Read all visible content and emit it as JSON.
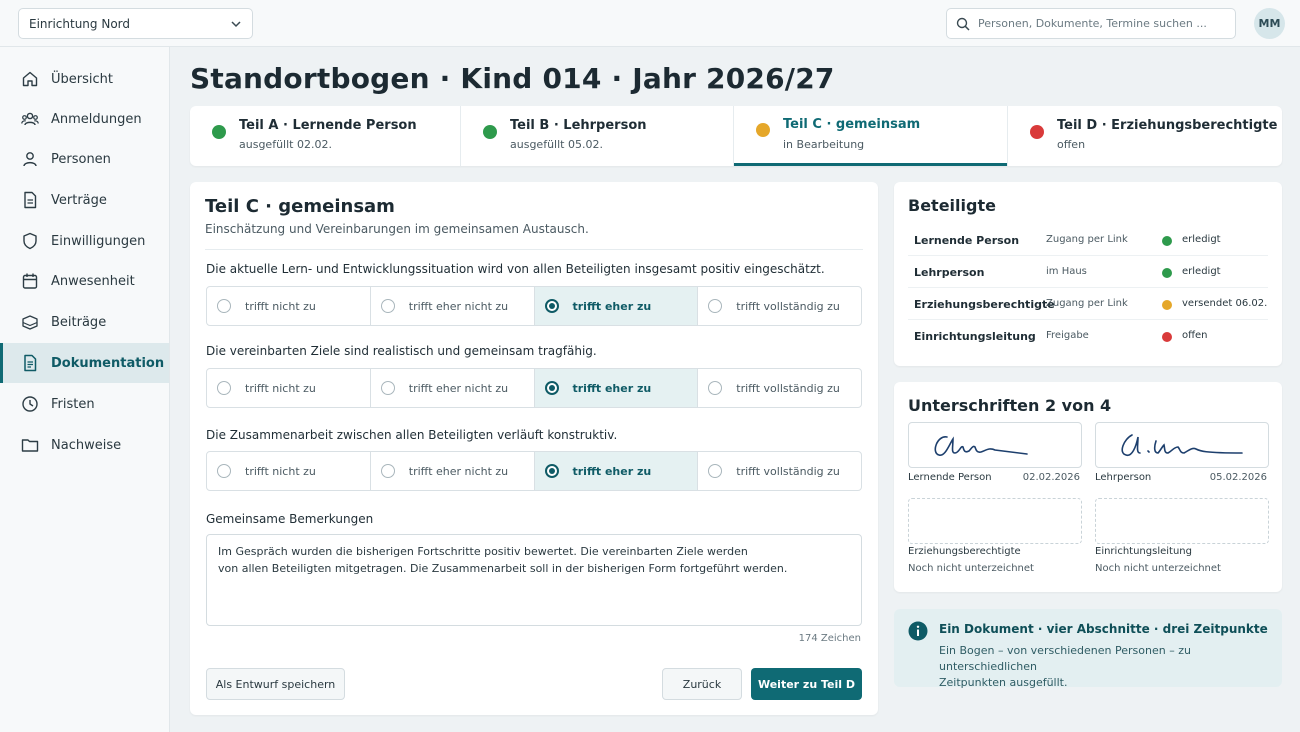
{
  "header": {
    "org_select": "Einrichtung Nord",
    "search_placeholder": "Personen, Dokumente, Termine suchen ...",
    "avatar": "MM"
  },
  "sidebar": {
    "items": [
      {
        "label": "Übersicht",
        "icon": "home-icon"
      },
      {
        "label": "Anmeldungen",
        "icon": "users-icon"
      },
      {
        "label": "Personen",
        "icon": "person-icon"
      },
      {
        "label": "Verträge",
        "icon": "document-icon"
      },
      {
        "label": "Einwilligungen",
        "icon": "shield-icon"
      },
      {
        "label": "Anwesenheit",
        "icon": "calendar-icon"
      },
      {
        "label": "Beiträge",
        "icon": "money-icon"
      },
      {
        "label": "Dokumentation",
        "icon": "document-list-icon",
        "active": true
      },
      {
        "label": "Fristen",
        "icon": "clock-icon"
      },
      {
        "label": "Nachweise",
        "icon": "folder-icon"
      }
    ]
  },
  "page": {
    "title": "Standortbogen · Kind 014 · Jahr 2026/27"
  },
  "steps": [
    {
      "title": "Teil A · Lernende Person",
      "subtitle": "ausgefüllt 02.02.",
      "status_color": "#2e9a4c"
    },
    {
      "title": "Teil B · Lehrperson",
      "subtitle": "ausgefüllt 05.02.",
      "status_color": "#2e9a4c"
    },
    {
      "title": "Teil C · gemeinsam",
      "subtitle": "in Bearbeitung",
      "status_color": "#e5a72a",
      "current": true
    },
    {
      "title": "Teil D · Erziehungsberechtigte",
      "subtitle": "offen",
      "status_color": "#d93a3a"
    }
  ],
  "section": {
    "title": "Teil C · gemeinsam",
    "subtitle": "Einschätzung und Vereinbarungen im gemeinsamen Austausch.",
    "options": [
      "trifft nicht zu",
      "trifft eher nicht zu",
      "trifft eher zu",
      "trifft vollständig zu"
    ],
    "questions": [
      {
        "text": "Die aktuelle Lern- und Entwicklungssituation wird von allen Beteiligten insgesamt positiv eingeschätzt.",
        "selected": 2
      },
      {
        "text": "Die vereinbarten Ziele sind realistisch und gemeinsam tragfähig.",
        "selected": 2
      },
      {
        "text": "Die Zusammenarbeit zwischen allen Beteiligten verläuft konstruktiv.",
        "selected": 2
      }
    ],
    "remarks_label": "Gemeinsame Bemerkungen",
    "remarks_line1": "Im Gespräch wurden die bisherigen Fortschritte positiv bewertet. Die vereinbarten Ziele werden",
    "remarks_line2": "von allen Beteiligten mitgetragen. Die Zusammenarbeit soll in der bisherigen Form fortgeführt werden.",
    "char_count": "174 Zeichen",
    "btn_draft": "Als Entwurf speichern",
    "btn_back": "Zurück",
    "btn_next": "Weiter zu Teil D"
  },
  "participants": {
    "title": "Beteiligte",
    "rows": [
      {
        "name": "Lernende Person",
        "access": "Zugang per Link",
        "status": "erledigt",
        "color": "#2e9a4c"
      },
      {
        "name": "Lehrperson",
        "access": "im Haus",
        "status": "erledigt",
        "color": "#2e9a4c"
      },
      {
        "name": "Erziehungsberechtigte",
        "access": "Zugang per Link",
        "status": "versendet 06.02.",
        "color": "#e5a72a"
      },
      {
        "name": "Einrichtungsleitung",
        "access": "Freigabe",
        "status": "offen",
        "color": "#d93a3a"
      }
    ]
  },
  "signatures": {
    "title": "Unterschriften 2 von 4",
    "items": [
      {
        "name": "Lernende Person",
        "date": "02.02.2026",
        "signed": true
      },
      {
        "name": "Lehrperson",
        "date": "05.02.2026",
        "signed": true
      },
      {
        "name": "Erziehungsberechtigte",
        "note": "Noch nicht unterzeichnet",
        "signed": false
      },
      {
        "name": "Einrichtungsleitung",
        "note": "Noch nicht unterzeichnet",
        "signed": false
      }
    ]
  },
  "info": {
    "title": "Ein Dokument · vier Abschnitte · drei Zeitpunkte",
    "line1": "Ein Bogen – von verschiedenen Personen – zu unterschiedlichen",
    "line2": "Zeitpunkten ausgefüllt."
  },
  "colors": {
    "accent": "#0f6a74",
    "done": "#2e9a4c",
    "pending": "#e5a72a",
    "open": "#d93a3a"
  }
}
